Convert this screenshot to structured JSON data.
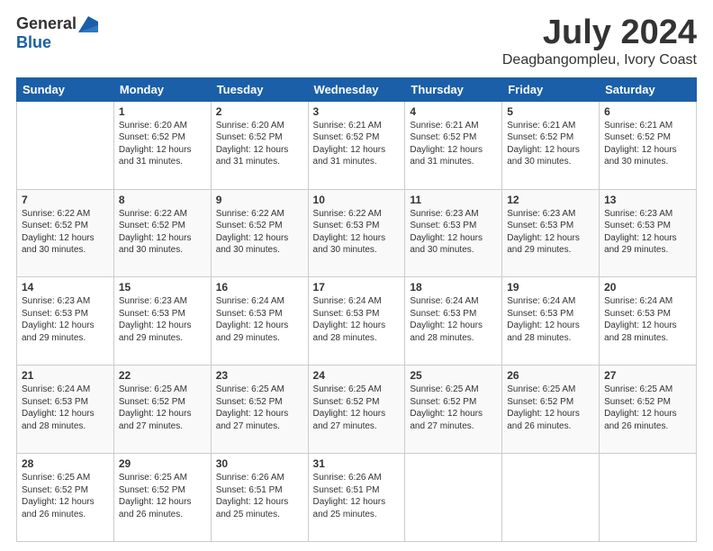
{
  "logo": {
    "general": "General",
    "blue": "Blue"
  },
  "header": {
    "title": "July 2024",
    "subtitle": "Deagbangompleu, Ivory Coast"
  },
  "days_of_week": [
    "Sunday",
    "Monday",
    "Tuesday",
    "Wednesday",
    "Thursday",
    "Friday",
    "Saturday"
  ],
  "weeks": [
    [
      {
        "day": "",
        "info": ""
      },
      {
        "day": "1",
        "info": "Sunrise: 6:20 AM\nSunset: 6:52 PM\nDaylight: 12 hours\nand 31 minutes."
      },
      {
        "day": "2",
        "info": "Sunrise: 6:20 AM\nSunset: 6:52 PM\nDaylight: 12 hours\nand 31 minutes."
      },
      {
        "day": "3",
        "info": "Sunrise: 6:21 AM\nSunset: 6:52 PM\nDaylight: 12 hours\nand 31 minutes."
      },
      {
        "day": "4",
        "info": "Sunrise: 6:21 AM\nSunset: 6:52 PM\nDaylight: 12 hours\nand 31 minutes."
      },
      {
        "day": "5",
        "info": "Sunrise: 6:21 AM\nSunset: 6:52 PM\nDaylight: 12 hours\nand 30 minutes."
      },
      {
        "day": "6",
        "info": "Sunrise: 6:21 AM\nSunset: 6:52 PM\nDaylight: 12 hours\nand 30 minutes."
      }
    ],
    [
      {
        "day": "7",
        "info": "Sunrise: 6:22 AM\nSunset: 6:52 PM\nDaylight: 12 hours\nand 30 minutes."
      },
      {
        "day": "8",
        "info": "Sunrise: 6:22 AM\nSunset: 6:52 PM\nDaylight: 12 hours\nand 30 minutes."
      },
      {
        "day": "9",
        "info": "Sunrise: 6:22 AM\nSunset: 6:52 PM\nDaylight: 12 hours\nand 30 minutes."
      },
      {
        "day": "10",
        "info": "Sunrise: 6:22 AM\nSunset: 6:53 PM\nDaylight: 12 hours\nand 30 minutes."
      },
      {
        "day": "11",
        "info": "Sunrise: 6:23 AM\nSunset: 6:53 PM\nDaylight: 12 hours\nand 30 minutes."
      },
      {
        "day": "12",
        "info": "Sunrise: 6:23 AM\nSunset: 6:53 PM\nDaylight: 12 hours\nand 29 minutes."
      },
      {
        "day": "13",
        "info": "Sunrise: 6:23 AM\nSunset: 6:53 PM\nDaylight: 12 hours\nand 29 minutes."
      }
    ],
    [
      {
        "day": "14",
        "info": "Sunrise: 6:23 AM\nSunset: 6:53 PM\nDaylight: 12 hours\nand 29 minutes."
      },
      {
        "day": "15",
        "info": "Sunrise: 6:23 AM\nSunset: 6:53 PM\nDaylight: 12 hours\nand 29 minutes."
      },
      {
        "day": "16",
        "info": "Sunrise: 6:24 AM\nSunset: 6:53 PM\nDaylight: 12 hours\nand 29 minutes."
      },
      {
        "day": "17",
        "info": "Sunrise: 6:24 AM\nSunset: 6:53 PM\nDaylight: 12 hours\nand 28 minutes."
      },
      {
        "day": "18",
        "info": "Sunrise: 6:24 AM\nSunset: 6:53 PM\nDaylight: 12 hours\nand 28 minutes."
      },
      {
        "day": "19",
        "info": "Sunrise: 6:24 AM\nSunset: 6:53 PM\nDaylight: 12 hours\nand 28 minutes."
      },
      {
        "day": "20",
        "info": "Sunrise: 6:24 AM\nSunset: 6:53 PM\nDaylight: 12 hours\nand 28 minutes."
      }
    ],
    [
      {
        "day": "21",
        "info": "Sunrise: 6:24 AM\nSunset: 6:53 PM\nDaylight: 12 hours\nand 28 minutes."
      },
      {
        "day": "22",
        "info": "Sunrise: 6:25 AM\nSunset: 6:52 PM\nDaylight: 12 hours\nand 27 minutes."
      },
      {
        "day": "23",
        "info": "Sunrise: 6:25 AM\nSunset: 6:52 PM\nDaylight: 12 hours\nand 27 minutes."
      },
      {
        "day": "24",
        "info": "Sunrise: 6:25 AM\nSunset: 6:52 PM\nDaylight: 12 hours\nand 27 minutes."
      },
      {
        "day": "25",
        "info": "Sunrise: 6:25 AM\nSunset: 6:52 PM\nDaylight: 12 hours\nand 27 minutes."
      },
      {
        "day": "26",
        "info": "Sunrise: 6:25 AM\nSunset: 6:52 PM\nDaylight: 12 hours\nand 26 minutes."
      },
      {
        "day": "27",
        "info": "Sunrise: 6:25 AM\nSunset: 6:52 PM\nDaylight: 12 hours\nand 26 minutes."
      }
    ],
    [
      {
        "day": "28",
        "info": "Sunrise: 6:25 AM\nSunset: 6:52 PM\nDaylight: 12 hours\nand 26 minutes."
      },
      {
        "day": "29",
        "info": "Sunrise: 6:25 AM\nSunset: 6:52 PM\nDaylight: 12 hours\nand 26 minutes."
      },
      {
        "day": "30",
        "info": "Sunrise: 6:26 AM\nSunset: 6:51 PM\nDaylight: 12 hours\nand 25 minutes."
      },
      {
        "day": "31",
        "info": "Sunrise: 6:26 AM\nSunset: 6:51 PM\nDaylight: 12 hours\nand 25 minutes."
      },
      {
        "day": "",
        "info": ""
      },
      {
        "day": "",
        "info": ""
      },
      {
        "day": "",
        "info": ""
      }
    ]
  ]
}
